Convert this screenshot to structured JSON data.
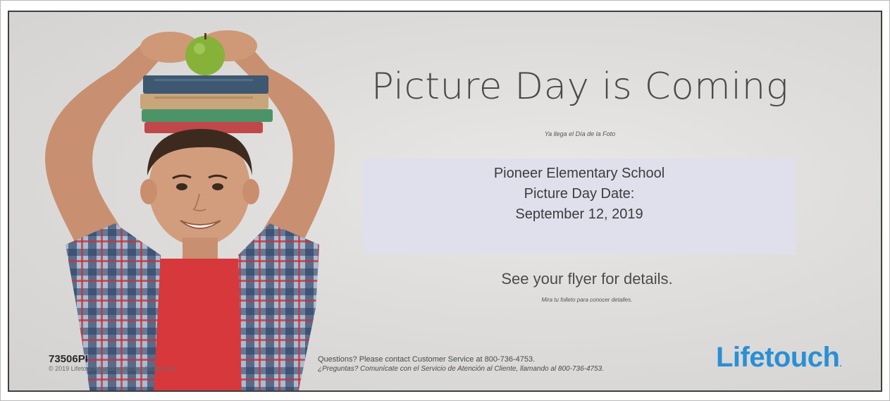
{
  "poster": {
    "headline": "Picture Day is Coming",
    "headline_es": "Ya llega el Día de la Foto",
    "info": {
      "school": "Pioneer Elementary School",
      "date_label": "Picture Day Date:",
      "date": "September 12, 2019"
    },
    "details": "See your flyer for details.",
    "details_es": "Mira tu folleto para conocer detalles.",
    "questions": "Questions? Please contact Customer Service at 800-736-4753.",
    "questions_es": "¿Preguntas? Comunícate con el Servicio de Atención al Cliente, llamando al 800-736-4753.",
    "logo_text": "Lifetouch",
    "logo_mark": ".",
    "code": "73506PI",
    "copyright": "© 2019 Lifetouch National School Studios Inc."
  },
  "photo": {
    "icon": "boy-with-books-and-apple-photo"
  },
  "colors": {
    "poster_background": "#dedddb",
    "info_box": "#dfe0ec",
    "logo": "#2b8fd4",
    "frame_border": "#3f3f3f"
  }
}
